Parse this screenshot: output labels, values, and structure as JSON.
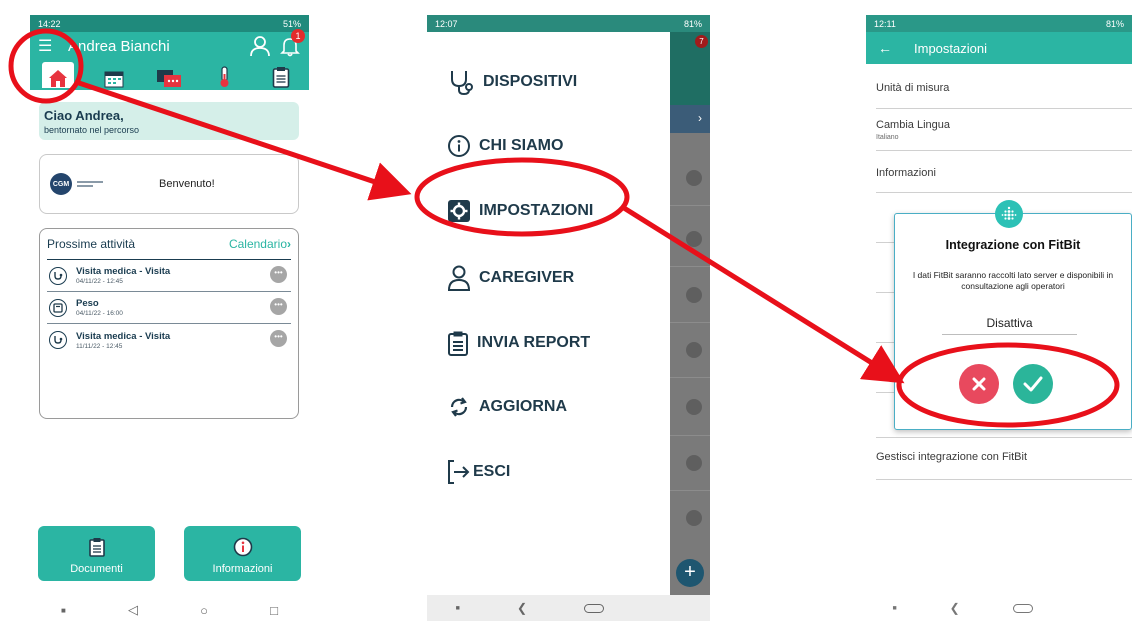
{
  "phone1": {
    "status_time": "14:22",
    "status_battery": "51%",
    "user_name": "Andrea Bianchi",
    "notification_count": "1",
    "greeting_title": "Ciao Andrea,",
    "greeting_subtitle": "bentornato nel percorso",
    "welcome_text": "Benvenuto!",
    "logo_text": "CGM",
    "activities_title": "Prossime attività",
    "calendar_link": "Calendario",
    "activities": [
      {
        "title": "Visita medica - Visita",
        "date": "04/11/22 - 12:45"
      },
      {
        "title": "Peso",
        "date": "04/11/22 - 16:00"
      },
      {
        "title": "Visita medica - Visita",
        "date": "11/11/22 - 12:45"
      }
    ],
    "documents_label": "Documenti",
    "info_label": "Informazioni"
  },
  "phone2": {
    "status_time": "12:07",
    "status_battery": "81%",
    "bg_badge": "7",
    "menu": [
      "DISPOSITIVI",
      "CHI SIAMO",
      "IMPOSTAZIONI",
      "CAREGIVER",
      "INVIA REPORT",
      "AGGIORNA",
      "ESCI"
    ]
  },
  "phone3": {
    "status_time": "12:11",
    "status_battery": "81%",
    "title": "Impostazioni",
    "settings": [
      "Unità di misura",
      "Cambia Lingua",
      "Informazioni",
      "Gestisci integrazione con FitBit"
    ],
    "language_value": "Italiano",
    "dialog_title": "Integrazione con FitBit",
    "dialog_body": "I dati FitBit saranno raccolti lato server e disponibili in consultazione agli operatori",
    "dialog_status": "Disattiva"
  },
  "colors": {
    "accent": "#2bb5a3",
    "annotation": "#e8101a",
    "text_dark": "#1f3a4a"
  }
}
